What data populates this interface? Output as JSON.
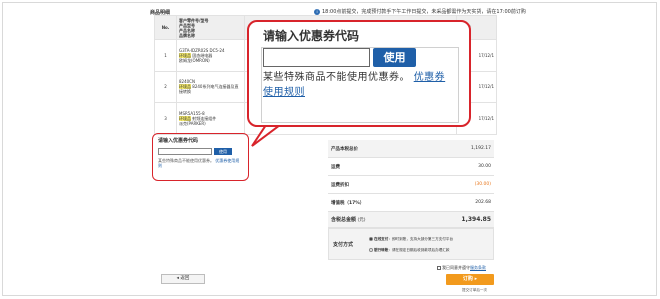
{
  "header": {
    "title": "商品明细",
    "notice": "18:00点前提交，完成预付款手下午工作日提交，未采品都需作为天实货，请在17:00前订购"
  },
  "table": {
    "col_no": "No.",
    "col_info": [
      "客户零件号/型号",
      "产品型号",
      "产品名称",
      "品牌名称"
    ],
    "col_date": "发货日",
    "rows": [
      {
        "no": "1",
        "model": "G3TA-IDZR02S DC5-24",
        "tag": "环境品",
        "name": "固态继电器",
        "brand": "欧姆龙(OMRON)",
        "date": "17/12/1"
      },
      {
        "no": "2",
        "model": "8240CN",
        "tag": "环境品",
        "name": "8240系列电气连接器及直接转换",
        "brand": "",
        "date": "17/12/1"
      },
      {
        "no": "3",
        "model": "MSR5A155-8",
        "tag": "环境品",
        "name": "射频连接组件",
        "brand": "派克(PARKER)",
        "date": "17/12/1"
      }
    ]
  },
  "coupon_mini": {
    "title": "请输入优惠券代码",
    "button": "使用",
    "note": "某些特殊商品不能使用优惠券。",
    "link": "优惠券使用规则"
  },
  "callout": {
    "title": "请输入优惠券代码",
    "input_value": "",
    "button": "使用",
    "note": "某些特殊商品不能使用优惠券。",
    "link": "优惠券使用规则"
  },
  "totals": {
    "subtotal_label": "产品本税总价",
    "subtotal_value": "1,192.17",
    "shipping_label": "运费",
    "shipping_value": "30.00",
    "discount_label": "运费折扣",
    "discount_value": "(30.00)",
    "tax_label": "增值税（17%）",
    "tax_value": "202.68",
    "total_label": "含税总金额",
    "total_unit": "(元)",
    "total_value": "1,394.85"
  },
  "payment": {
    "label": "支付方式",
    "option1_bold": "在线支付",
    "option1_text": "：即时到账，支持大部分第三方支付平台",
    "option2_bold": "银行转账",
    "option2_text": "：请在规定日期后收到款项后办理汇款"
  },
  "footer": {
    "back": "返回",
    "agree_text": "我已同意并遵守",
    "agree_link": "服务条款",
    "order": "订购",
    "after_text": "提交订单后一次"
  }
}
